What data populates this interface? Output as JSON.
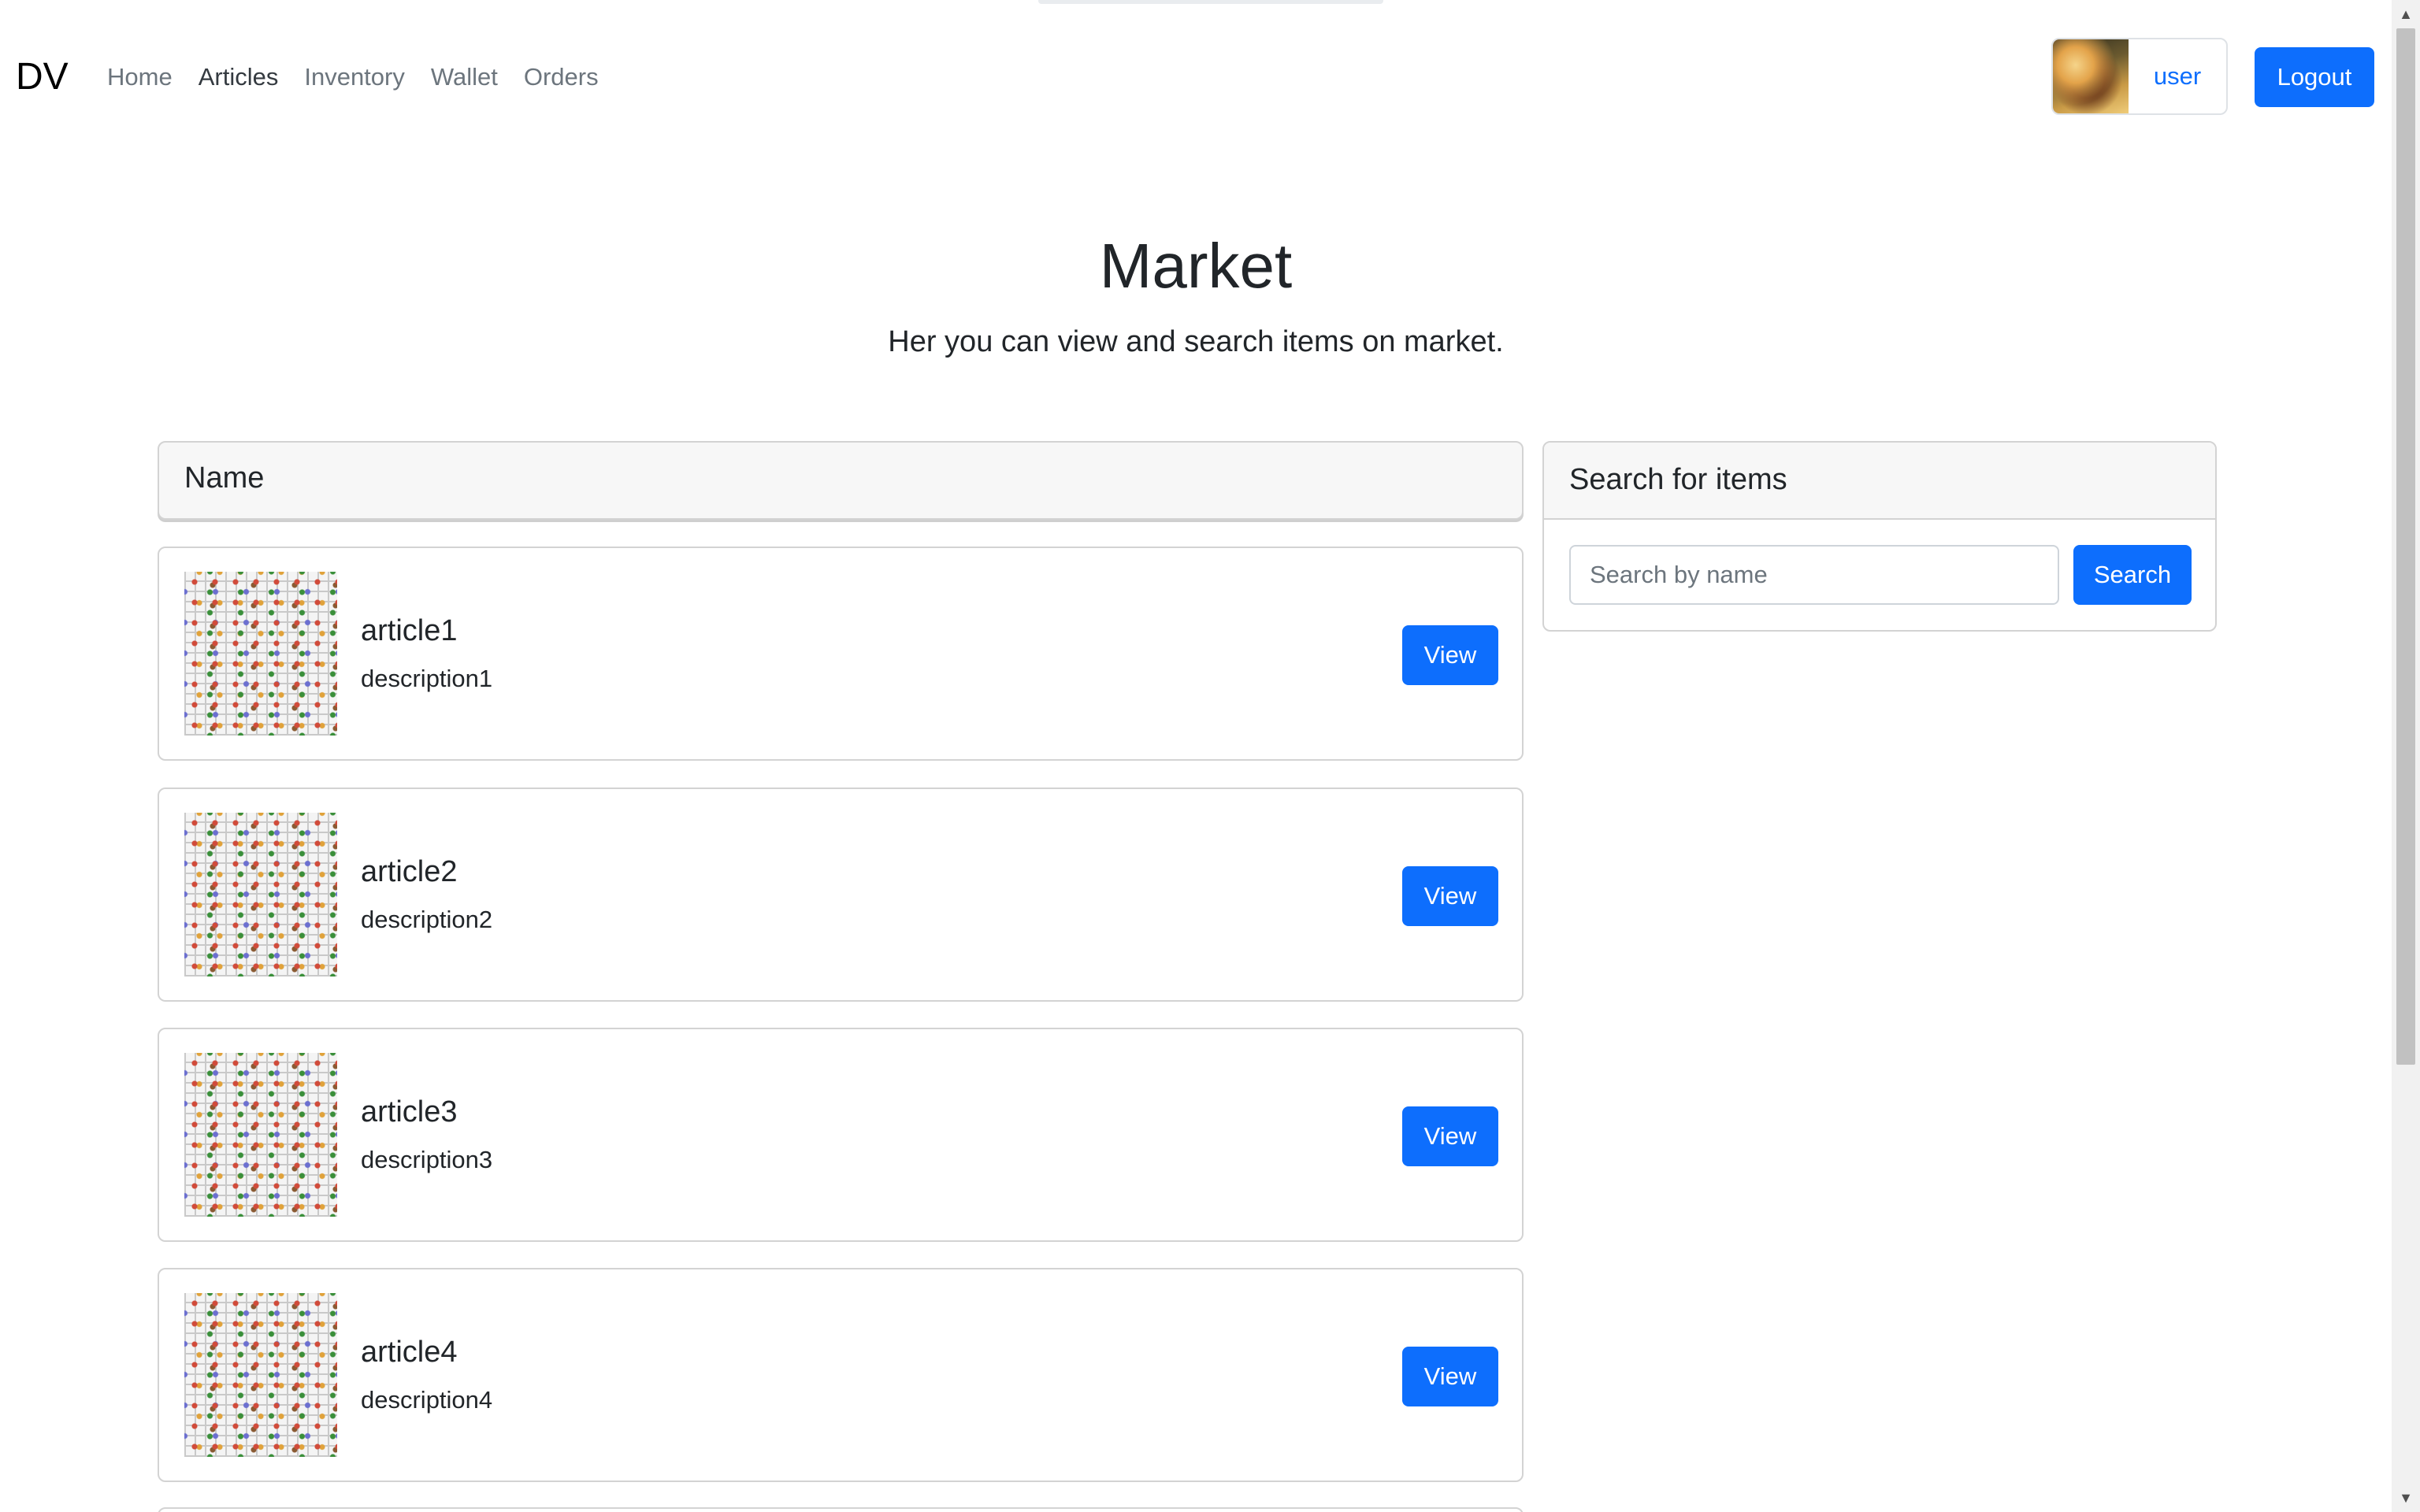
{
  "navbar": {
    "brand": "DV",
    "links": [
      {
        "label": "Home",
        "active": false
      },
      {
        "label": "Articles",
        "active": true
      },
      {
        "label": "Inventory",
        "active": false
      },
      {
        "label": "Wallet",
        "active": false
      },
      {
        "label": "Orders",
        "active": false
      }
    ],
    "user_label": "user",
    "logout_label": "Logout"
  },
  "hero": {
    "title": "Market",
    "subtitle": "Her you can view and search items on market."
  },
  "list": {
    "header": "Name",
    "view_label": "View",
    "articles": [
      {
        "title": "article1",
        "description": "description1"
      },
      {
        "title": "article2",
        "description": "description2"
      },
      {
        "title": "article3",
        "description": "description3"
      },
      {
        "title": "article4",
        "description": "description4"
      }
    ]
  },
  "search": {
    "header": "Search for items",
    "placeholder": "Search by name",
    "value": "",
    "button_label": "Search"
  },
  "colors": {
    "primary": "#0d6efd",
    "muted_nav": "#6c757d",
    "card_border": "#d3d3d3",
    "card_header_bg": "#f7f7f7"
  },
  "icons": {
    "scroll_up": "▲",
    "scroll_down": "▼"
  }
}
